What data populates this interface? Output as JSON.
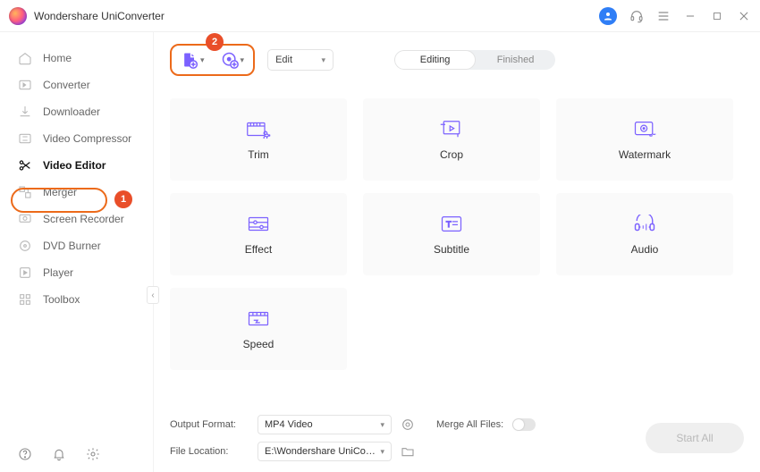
{
  "app": {
    "title": "Wondershare UniConverter"
  },
  "sidebar": {
    "items": [
      {
        "label": "Home"
      },
      {
        "label": "Converter"
      },
      {
        "label": "Downloader"
      },
      {
        "label": "Video Compressor"
      },
      {
        "label": "Video Editor"
      },
      {
        "label": "Merger"
      },
      {
        "label": "Screen Recorder"
      },
      {
        "label": "DVD Burner"
      },
      {
        "label": "Player"
      },
      {
        "label": "Toolbox"
      }
    ]
  },
  "callouts": {
    "one": "1",
    "two": "2"
  },
  "toolbar": {
    "edit_label": "Edit",
    "tab_editing": "Editing",
    "tab_finished": "Finished"
  },
  "cards": {
    "trim": "Trim",
    "crop": "Crop",
    "watermark": "Watermark",
    "effect": "Effect",
    "subtitle": "Subtitle",
    "audio": "Audio",
    "speed": "Speed"
  },
  "bottom": {
    "output_format_label": "Output Format:",
    "output_format_value": "MP4 Video",
    "file_location_label": "File Location:",
    "file_location_value": "E:\\Wondershare UniConverter",
    "merge_label": "Merge All Files:",
    "start_all": "Start All"
  }
}
